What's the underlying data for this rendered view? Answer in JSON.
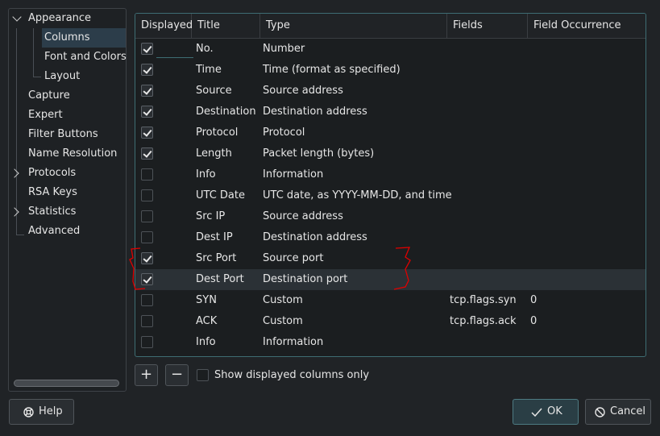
{
  "sidebar": {
    "items": [
      {
        "label": "Appearance",
        "expanded": true
      },
      {
        "label": "Columns",
        "selected": true
      },
      {
        "label": "Font and Colors"
      },
      {
        "label": "Layout"
      },
      {
        "label": "Capture"
      },
      {
        "label": "Expert"
      },
      {
        "label": "Filter Buttons"
      },
      {
        "label": "Name Resolution"
      },
      {
        "label": "Protocols",
        "collapsed": true
      },
      {
        "label": "RSA Keys"
      },
      {
        "label": "Statistics",
        "collapsed": true
      },
      {
        "label": "Advanced"
      }
    ]
  },
  "table": {
    "headers": [
      "Displayed",
      "Title",
      "Type",
      "Fields",
      "Field Occurrence"
    ],
    "rows": [
      {
        "displayed": true,
        "title": "No.",
        "type": "Number",
        "fields": "",
        "occurrence": ""
      },
      {
        "displayed": true,
        "title": "Time",
        "type": "Time (format as specified)",
        "fields": "",
        "occurrence": ""
      },
      {
        "displayed": true,
        "title": "Source",
        "type": "Source address",
        "fields": "",
        "occurrence": ""
      },
      {
        "displayed": true,
        "title": "Destination",
        "type": "Destination address",
        "fields": "",
        "occurrence": ""
      },
      {
        "displayed": true,
        "title": "Protocol",
        "type": "Protocol",
        "fields": "",
        "occurrence": ""
      },
      {
        "displayed": true,
        "title": "Length",
        "type": "Packet length (bytes)",
        "fields": "",
        "occurrence": ""
      },
      {
        "displayed": false,
        "title": "Info",
        "type": "Information",
        "fields": "",
        "occurrence": ""
      },
      {
        "displayed": false,
        "title": "UTC Date",
        "type": "UTC date, as YYYY-MM-DD, and time",
        "fields": "",
        "occurrence": ""
      },
      {
        "displayed": false,
        "title": "Src IP",
        "type": "Source address",
        "fields": "",
        "occurrence": ""
      },
      {
        "displayed": false,
        "title": "Dest IP",
        "type": "Destination address",
        "fields": "",
        "occurrence": ""
      },
      {
        "displayed": true,
        "title": "Src Port",
        "type": "Source port",
        "fields": "",
        "occurrence": ""
      },
      {
        "displayed": true,
        "title": "Dest Port",
        "type": "Destination port",
        "fields": "",
        "occurrence": "",
        "selected": true
      },
      {
        "displayed": false,
        "title": "SYN",
        "type": "Custom",
        "fields": "tcp.flags.syn",
        "occurrence": "0"
      },
      {
        "displayed": false,
        "title": "ACK",
        "type": "Custom",
        "fields": "tcp.flags.ack",
        "occurrence": "0"
      },
      {
        "displayed": false,
        "title": "Info",
        "type": "Information",
        "fields": "",
        "occurrence": ""
      }
    ]
  },
  "toolbar": {
    "add_label": "+",
    "remove_label": "−",
    "show_displayed_only_label": "Show displayed columns only",
    "show_displayed_only_checked": false
  },
  "buttons": {
    "help_label": "Help",
    "ok_label": "OK",
    "cancel_label": "Cancel"
  },
  "colors": {
    "accent": "#3e6d73",
    "annotation": "#e00000"
  },
  "icons": {
    "help": "lifebuoy-icon",
    "ok": "checkmark-icon",
    "cancel": "cancel-icon"
  }
}
